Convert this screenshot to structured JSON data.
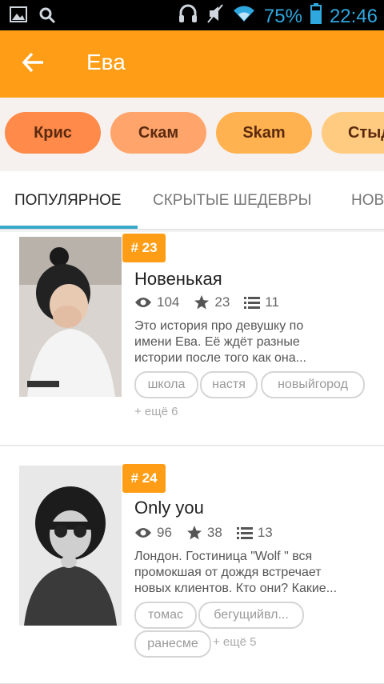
{
  "statusbar": {
    "battery": "75%",
    "time": "22:46"
  },
  "appbar": {
    "title": "Ева"
  },
  "chips": [
    {
      "label": "Крис",
      "bg": "#ff8a4a"
    },
    {
      "label": "Скам",
      "bg": "#ffa56b"
    },
    {
      "label": "Skam",
      "bg": "#ffb24f"
    },
    {
      "label": "Стыд",
      "bg": "#ffcb80"
    }
  ],
  "tabs": [
    {
      "label": "ПОПУЛЯРНОЕ"
    },
    {
      "label": "СКРЫТЫЕ ШЕДЕВРЫ"
    },
    {
      "label": "НОВ"
    }
  ],
  "stories": [
    {
      "rank": "# 23",
      "title": "Новенькая",
      "views": "104",
      "stars": "23",
      "parts": "11",
      "desc_lines": [
        "Это история про девушку по",
        "имени Ева. Её ждёт разные",
        "истории после того как она..."
      ],
      "tags": [
        "школа",
        "настя",
        "новыйгород"
      ],
      "more": "+ ещё 6"
    },
    {
      "rank": "# 24",
      "title": " Only you",
      "views": "96",
      "stars": "38",
      "parts": "13",
      "desc_lines": [
        "Лондон. Гостиница \"Wolf \" вся",
        "промокшая от дождя встречает",
        "новых клиентов. Кто они? Какие..."
      ],
      "tags": [
        "томас",
        "бегущийвл...",
        "ранесме"
      ],
      "more": "+ ещё 5"
    }
  ],
  "colors": {
    "accent": "#ff9e16",
    "tab_indicator": "#39a9c8"
  }
}
